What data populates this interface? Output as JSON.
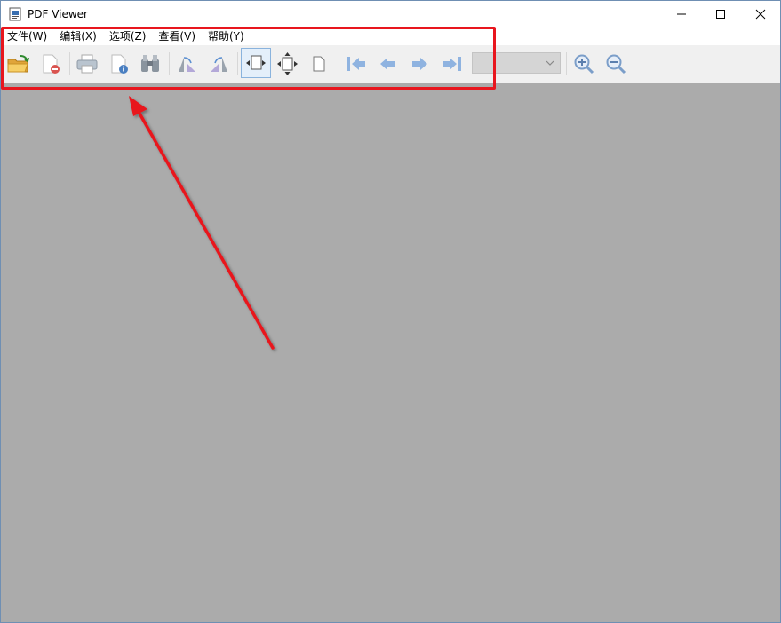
{
  "window": {
    "title": "PDF Viewer"
  },
  "menu": {
    "items": [
      {
        "label": "文件(W)"
      },
      {
        "label": "编辑(X)"
      },
      {
        "label": "选项(Z)"
      },
      {
        "label": "查看(V)"
      },
      {
        "label": "帮助(Y)"
      }
    ]
  },
  "toolbar": {
    "buttons": [
      {
        "icon": "open-folder-icon"
      },
      {
        "icon": "close-document-icon"
      },
      {
        "icon": "print-icon"
      },
      {
        "icon": "document-properties-icon"
      },
      {
        "icon": "find-binoculars-icon"
      },
      {
        "icon": "rotate-left-icon"
      },
      {
        "icon": "rotate-right-icon"
      },
      {
        "icon": "fit-width-icon",
        "active": true
      },
      {
        "icon": "fit-page-icon"
      },
      {
        "icon": "actual-size-icon"
      },
      {
        "icon": "first-page-icon"
      },
      {
        "icon": "previous-page-icon"
      },
      {
        "icon": "next-page-icon"
      },
      {
        "icon": "last-page-icon"
      },
      {
        "icon": "zoom-in-icon"
      },
      {
        "icon": "zoom-out-icon"
      }
    ],
    "page_select": {
      "value": ""
    }
  },
  "colors": {
    "document_background": "#ababab",
    "toolbar_background": "#f0f0f0",
    "annotation": "#e8161e",
    "nav_arrow": "#8fb3e0"
  }
}
